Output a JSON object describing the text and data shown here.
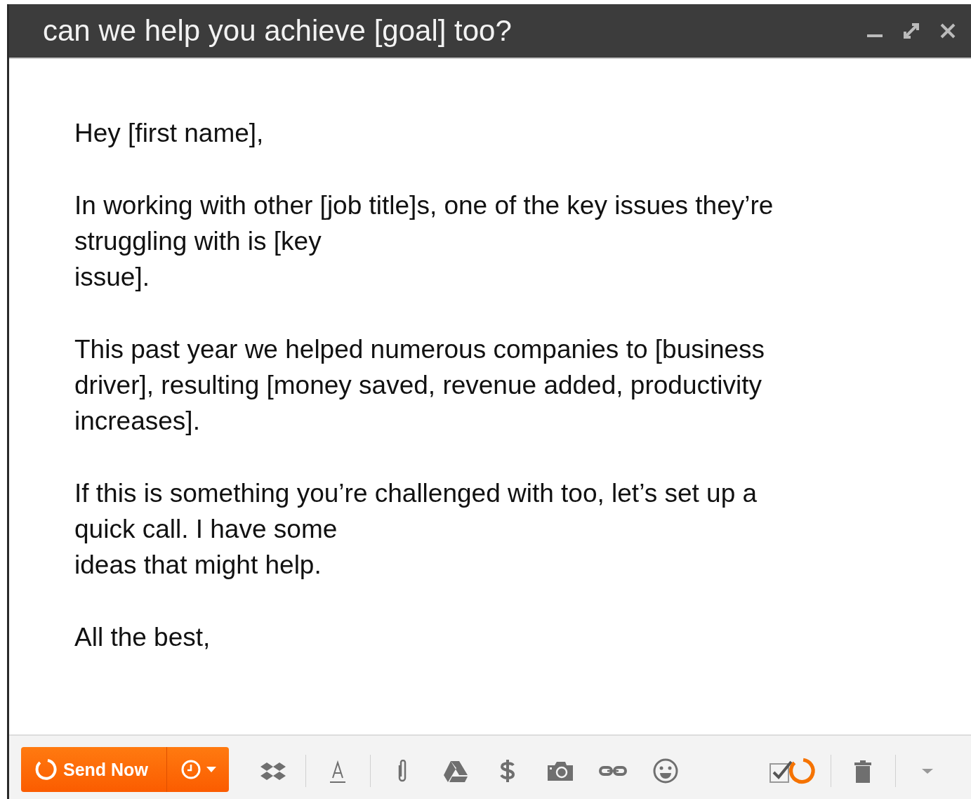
{
  "window": {
    "title": "can we help you achieve [goal] too?"
  },
  "body": {
    "paragraphs": [
      [
        "Hey [first name],"
      ],
      [
        "In working with other [job title]s, one of the key issues they’re",
        "struggling with is [key",
        "issue]."
      ],
      [
        "This past year we helped numerous companies to [business",
        "driver], resulting [money saved, revenue added, productivity",
        "increases]."
      ],
      [
        "If this is something you’re challenged with too, let’s set up a",
        "quick call. I have some",
        "ideas that might help."
      ],
      [
        "All the best,"
      ]
    ]
  },
  "toolbar": {
    "send_button": "Send Now"
  }
}
